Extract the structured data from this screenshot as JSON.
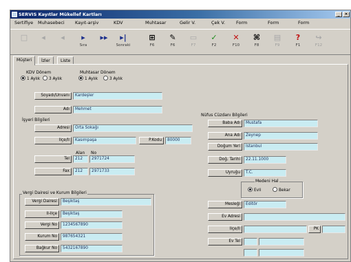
{
  "window": {
    "title": "SERVIS Kayıtlar   Mükellef Kartları"
  },
  "menu": [
    "Sertifiye",
    "Muhasebeci",
    "Kayıt-arşiv",
    "KDV",
    "Muhtasar",
    "Gelir V.",
    "Çek V.",
    "Form",
    "Form",
    "Form"
  ],
  "toolbar": [
    {
      "icon": "□",
      "label": "",
      "enabled": false,
      "name": "new-record-icon"
    },
    {
      "icon": "◂",
      "label": "",
      "enabled": false,
      "name": "first-record-icon"
    },
    {
      "icon": "◂",
      "label": "",
      "enabled": false,
      "name": "previous-record-icon"
    },
    {
      "icon": "▸",
      "label": "Sıra",
      "enabled": true,
      "name": "next-record-icon"
    },
    {
      "icon": "▸▸",
      "label": "",
      "enabled": true,
      "name": "forward-icon"
    },
    {
      "icon": "▸|",
      "label": "Sonraki",
      "enabled": true,
      "name": "last-record-icon"
    },
    {
      "icon": "⊞",
      "label": "F6",
      "enabled": true,
      "name": "search-icon"
    },
    {
      "icon": "✎",
      "label": "F6",
      "enabled": true,
      "name": "edit-icon"
    },
    {
      "icon": "▭",
      "label": "F7",
      "enabled": false,
      "name": "copy-icon"
    },
    {
      "icon": "✓",
      "label": "F2",
      "enabled": true,
      "name": "save-icon"
    },
    {
      "icon": "✕",
      "label": "F10",
      "enabled": true,
      "name": "delete-icon"
    },
    {
      "icon": "⌘",
      "label": "F8",
      "enabled": true,
      "name": "tools-icon"
    },
    {
      "icon": "▤",
      "label": "F9",
      "enabled": false,
      "name": "print-icon"
    },
    {
      "icon": "?",
      "label": "F1",
      "enabled": true,
      "name": "help-icon"
    },
    {
      "icon": "↪",
      "label": "F12",
      "enabled": false,
      "name": "exit-icon"
    }
  ],
  "tabs": [
    "Müşteri",
    "İzler",
    "Liste"
  ],
  "kdv_donem": {
    "label": "KDV Dönem",
    "options": [
      "1 Aylık",
      "3 Aylık"
    ],
    "selected": 0
  },
  "muhtasar_donem": {
    "label": "Muhtasar Dönem",
    "options": [
      "1 Aylık",
      "3 Aylık"
    ],
    "selected": 0
  },
  "soyadi": {
    "label": "Soyadı/Ünvanı",
    "value": "Kardeşler"
  },
  "adi": {
    "label": "Adı",
    "value": "Mehmet"
  },
  "isyeri": {
    "heading": "İşyeri Bilgileri",
    "adres_label": "Adresi",
    "adres_value": "Orta Sokağı",
    "ilce_label": "İlçe/İl",
    "ilce_value": "Kasımpaşa",
    "posta_label": "P.Kodu",
    "posta_value": "80000",
    "kod_header": "Alan",
    "no_header": "No",
    "tel_label": "Tel",
    "tel_kod": "212",
    "tel_no": "2971724",
    "fax_label": "Fax",
    "fax_kod": "212",
    "fax_no": "2971733"
  },
  "nufus": {
    "heading": "Nüfus Cüzdanı Bilgileri",
    "baba_label": "Baba Adı",
    "baba_value": "Mustafa",
    "ana_label": "Ana Adı",
    "ana_value": "Zeynep",
    "dogum_yeri_label": "Doğum Yeri",
    "dogum_yeri_value": "İstanbul",
    "dogum_tarihi_label": "Doğ. Tarihi",
    "dogum_tarihi_value": "22.11.1000",
    "uyruk_label": "Uyruğu",
    "uyruk_value": "T.C."
  },
  "medeni_hal": {
    "label": "Medeni Hal",
    "options": [
      "Evli",
      "Bekar"
    ],
    "selected": 0
  },
  "vergi": {
    "heading": "Vergi Dairesi ve Kurum Bilgileri",
    "daire_label": "Vergi Dairesi",
    "daire_value": "Beşiktaş",
    "ilce_label": "İl-İlçe",
    "ilce_value": "Beşiktaş",
    "vno_label": "Vergi No",
    "vno_value": "1234567890",
    "kurum_label": "Kurum No",
    "kurum_value": "987654321",
    "bagkur_label": "Bağkur No",
    "bagkur_value": "5432167890"
  },
  "diger": {
    "meslek_label": "Mesleği",
    "meslek_value": "Editör",
    "ev_adres_label": "Ev Adresi",
    "ev_adres_value": "",
    "ev_ilce_label": "İlçe/İl",
    "ev_ilce_value": "",
    "pk_label": "PK",
    "pk_value": "",
    "ev_tel_label": "Ev Tel",
    "ev_tel_kod": "",
    "ev_tel_no": ""
  },
  "colors": {
    "field_bg": "#c9ecf2",
    "title_start": "#0a246a",
    "title_end": "#a6caf0",
    "window_bg": "#d4d0c8"
  }
}
